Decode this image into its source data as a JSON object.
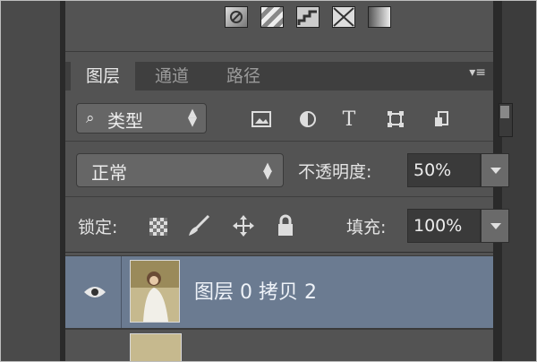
{
  "tabs": [
    {
      "label": "图层",
      "active": true
    },
    {
      "label": "通道",
      "active": false
    },
    {
      "label": "路径",
      "active": false
    }
  ],
  "filter": {
    "label": "类型",
    "icons": [
      "image-filter-icon",
      "adjustment-filter-icon",
      "type-filter-icon",
      "shape-filter-icon",
      "smart-object-filter-icon"
    ]
  },
  "blend": {
    "mode": "正常",
    "opacity_label": "不透明度:",
    "opacity_value": "50%"
  },
  "lock": {
    "label": "锁定:",
    "fill_label": "填充:",
    "fill_value": "100%"
  },
  "layers": [
    {
      "name": "图层 0 拷贝 2",
      "visible": true,
      "selected": true
    }
  ],
  "colors": {
    "accent_selected": "#6b7b91",
    "panel": "#535353"
  }
}
